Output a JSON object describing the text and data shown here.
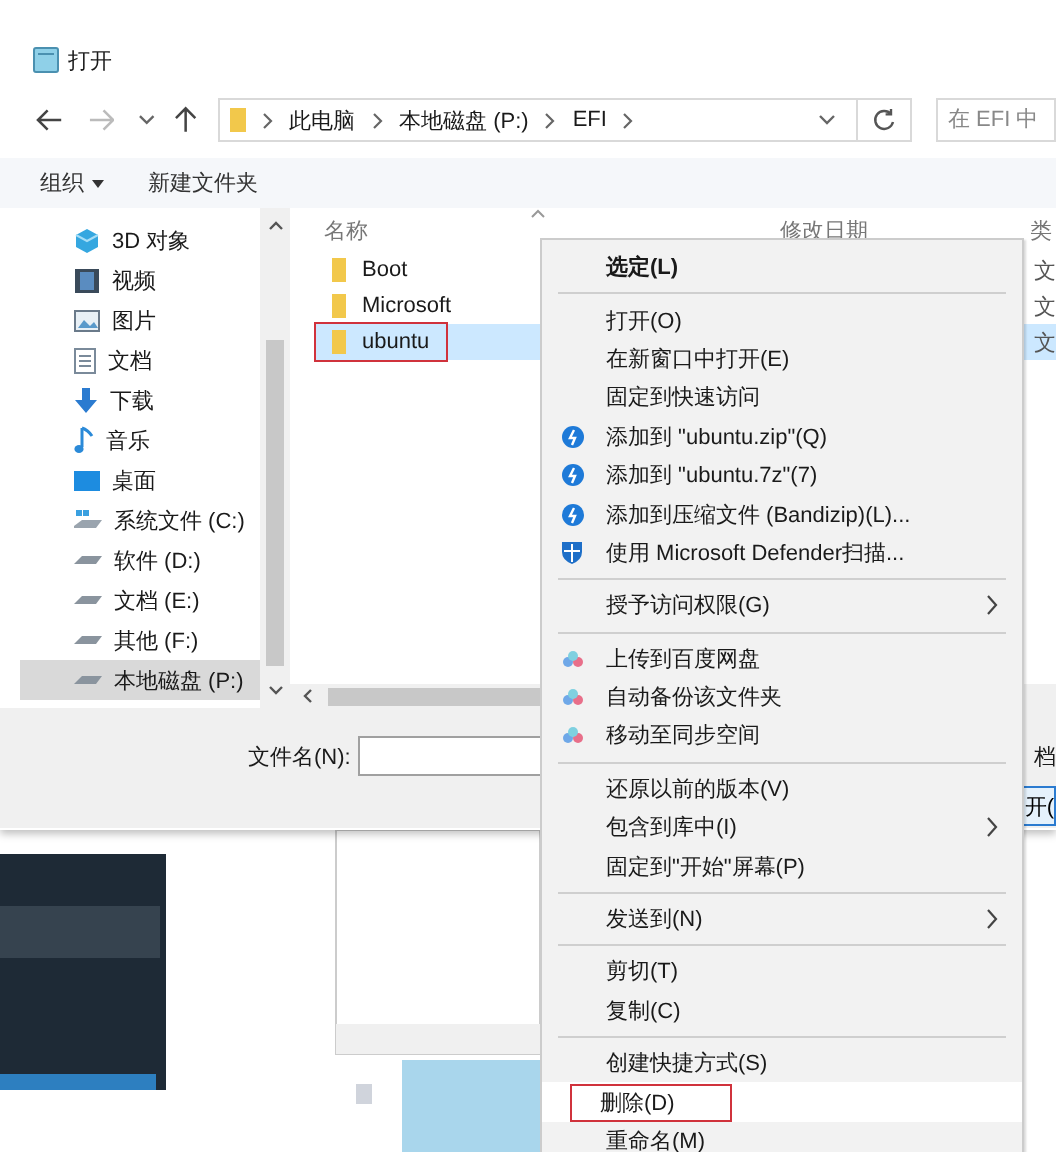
{
  "window": {
    "title": "打开"
  },
  "address_bar": {
    "path": [
      "此电脑",
      "本地磁盘 (P:)",
      "EFI"
    ],
    "search_placeholder": "在 EFI 中"
  },
  "toolbar": [
    {
      "label": "组织",
      "dropdown": true
    },
    {
      "label": "新建文件夹",
      "dropdown": false
    }
  ],
  "sidebar": {
    "items": [
      {
        "label": "3D 对象",
        "kind": "cube",
        "selected": false
      },
      {
        "label": "视频",
        "kind": "video",
        "selected": false
      },
      {
        "label": "图片",
        "kind": "picture",
        "selected": false
      },
      {
        "label": "文档",
        "kind": "document",
        "selected": false
      },
      {
        "label": "下载",
        "kind": "download",
        "selected": false
      },
      {
        "label": "音乐",
        "kind": "music",
        "selected": false
      },
      {
        "label": "桌面",
        "kind": "desktop",
        "selected": false
      },
      {
        "label": "系统文件 (C:)",
        "kind": "system-drive",
        "selected": false
      },
      {
        "label": "软件 (D:)",
        "kind": "drive",
        "selected": false
      },
      {
        "label": "文档 (E:)",
        "kind": "drive",
        "selected": false
      },
      {
        "label": "其他 (F:)",
        "kind": "drive",
        "selected": false
      },
      {
        "label": "本地磁盘 (P:)",
        "kind": "drive",
        "selected": true
      }
    ]
  },
  "file_list": {
    "columns": [
      "名称",
      "修改日期",
      "类"
    ],
    "rows": [
      {
        "name": "Boot",
        "type": "文",
        "selected": false
      },
      {
        "name": "Microsoft",
        "type": "文",
        "selected": false
      },
      {
        "name": "ubuntu",
        "type": "文",
        "selected": true
      }
    ]
  },
  "footer": {
    "filename_label": "文件名(N):",
    "type_fragment": "档",
    "open_button": "开("
  },
  "context_menu": {
    "sections": [
      [
        {
          "label": "选定(L)",
          "kind": "plain",
          "bold": true,
          "submenu": false,
          "highlighted": false
        }
      ],
      [
        {
          "label": "打开(O)",
          "kind": "plain",
          "bold": false,
          "submenu": false,
          "highlighted": false
        },
        {
          "label": "在新窗口中打开(E)",
          "kind": "plain",
          "bold": false,
          "submenu": false,
          "highlighted": false
        },
        {
          "label": "固定到快速访问",
          "kind": "plain",
          "bold": false,
          "submenu": false,
          "highlighted": false
        },
        {
          "label": "添加到 \"ubuntu.zip\"(Q)",
          "kind": "bandizip",
          "bold": false,
          "submenu": false,
          "highlighted": false
        },
        {
          "label": "添加到 \"ubuntu.7z\"(7)",
          "kind": "bandizip",
          "bold": false,
          "submenu": false,
          "highlighted": false
        },
        {
          "label": "添加到压缩文件 (Bandizip)(L)...",
          "kind": "bandizip",
          "bold": false,
          "submenu": false,
          "highlighted": false
        },
        {
          "label": "使用 Microsoft Defender扫描...",
          "kind": "shield",
          "bold": false,
          "submenu": false,
          "highlighted": false
        }
      ],
      [
        {
          "label": "授予访问权限(G)",
          "kind": "plain",
          "bold": false,
          "submenu": true,
          "highlighted": false
        }
      ],
      [
        {
          "label": "上传到百度网盘",
          "kind": "cloud",
          "bold": false,
          "submenu": false,
          "highlighted": false
        },
        {
          "label": "自动备份该文件夹",
          "kind": "cloud",
          "bold": false,
          "submenu": false,
          "highlighted": false
        },
        {
          "label": "移动至同步空间",
          "kind": "cloud",
          "bold": false,
          "submenu": false,
          "highlighted": false
        }
      ],
      [
        {
          "label": "还原以前的版本(V)",
          "kind": "plain",
          "bold": false,
          "submenu": false,
          "highlighted": false
        },
        {
          "label": "包含到库中(I)",
          "kind": "plain",
          "bold": false,
          "submenu": true,
          "highlighted": false
        },
        {
          "label": "固定到\"开始\"屏幕(P)",
          "kind": "plain",
          "bold": false,
          "submenu": false,
          "highlighted": false
        }
      ],
      [
        {
          "label": "发送到(N)",
          "kind": "plain",
          "bold": false,
          "submenu": true,
          "highlighted": false
        }
      ],
      [
        {
          "label": "剪切(T)",
          "kind": "plain",
          "bold": false,
          "submenu": false,
          "highlighted": false
        },
        {
          "label": "复制(C)",
          "kind": "plain",
          "bold": false,
          "submenu": false,
          "highlighted": false
        }
      ],
      [
        {
          "label": "创建快捷方式(S)",
          "kind": "plain",
          "bold": false,
          "submenu": false,
          "highlighted": false
        },
        {
          "label": "删除(D)",
          "kind": "plain",
          "bold": false,
          "submenu": false,
          "highlighted": true
        },
        {
          "label": "重命名(M)",
          "kind": "plain",
          "bold": false,
          "submenu": false,
          "highlighted": false
        }
      ]
    ]
  }
}
